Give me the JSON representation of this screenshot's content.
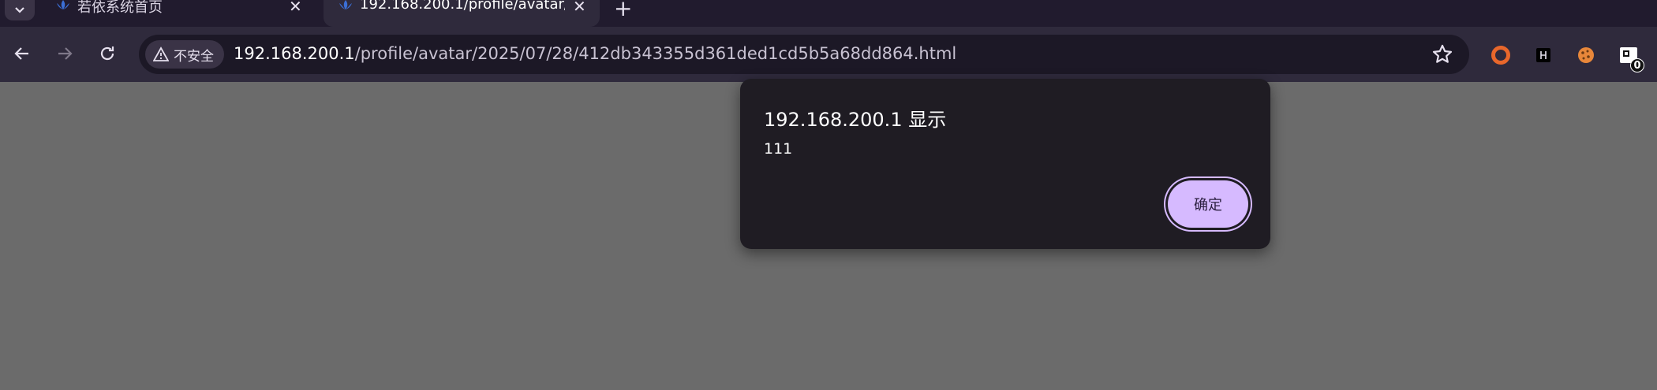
{
  "tabs": [
    {
      "title": "若依系统首页",
      "active": false
    },
    {
      "title": "192.168.200.1/profile/avatar/",
      "active": true
    }
  ],
  "omnibox": {
    "security_label": "不安全",
    "url_host": "192.168.200.1",
    "url_path": "/profile/avatar/2025/07/28/412db343355d361ded1cd5b5a68dd864.html"
  },
  "extensions": [
    {
      "icon": "ring-extension-icon",
      "color": "#e8672b"
    },
    {
      "icon": "h-extension-icon",
      "color": "#000000"
    },
    {
      "icon": "cookie-extension-icon",
      "color": "#e8873a"
    },
    {
      "icon": "tag-extension-icon",
      "badge": "0"
    }
  ],
  "dialog": {
    "title": "192.168.200.1 显示",
    "message": "111",
    "ok_label": "确定"
  },
  "colors": {
    "page_background": "#6b6b6b",
    "toolbar": "#2f2a3c",
    "dialog_background": "#1f1c23",
    "button_accent": "#d6baff"
  }
}
